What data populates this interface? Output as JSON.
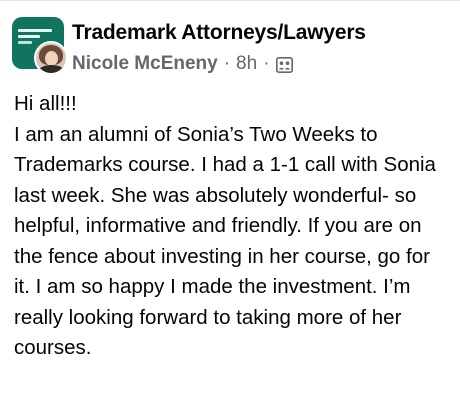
{
  "post": {
    "group_name": "Trademark Attorneys/Lawyers",
    "author": "Nicole McEneny",
    "separator": "·",
    "time": "8h",
    "audience_icon": "members-group-icon",
    "greeting": "Hi all!!!",
    "body": "I am an alumni of Sonia’s Two Weeks to Trademarks course. I had a 1-1 call with Sonia last week. She was absolutely wonderful- so helpful, informative and friendly. If you are on the fence about investing in her course, go for it. I am so happy I made the investment. I’m really looking forward to taking more of her courses."
  },
  "colors": {
    "group_avatar": "#10745f",
    "meta_text": "#65676b",
    "body_text": "#050505"
  }
}
